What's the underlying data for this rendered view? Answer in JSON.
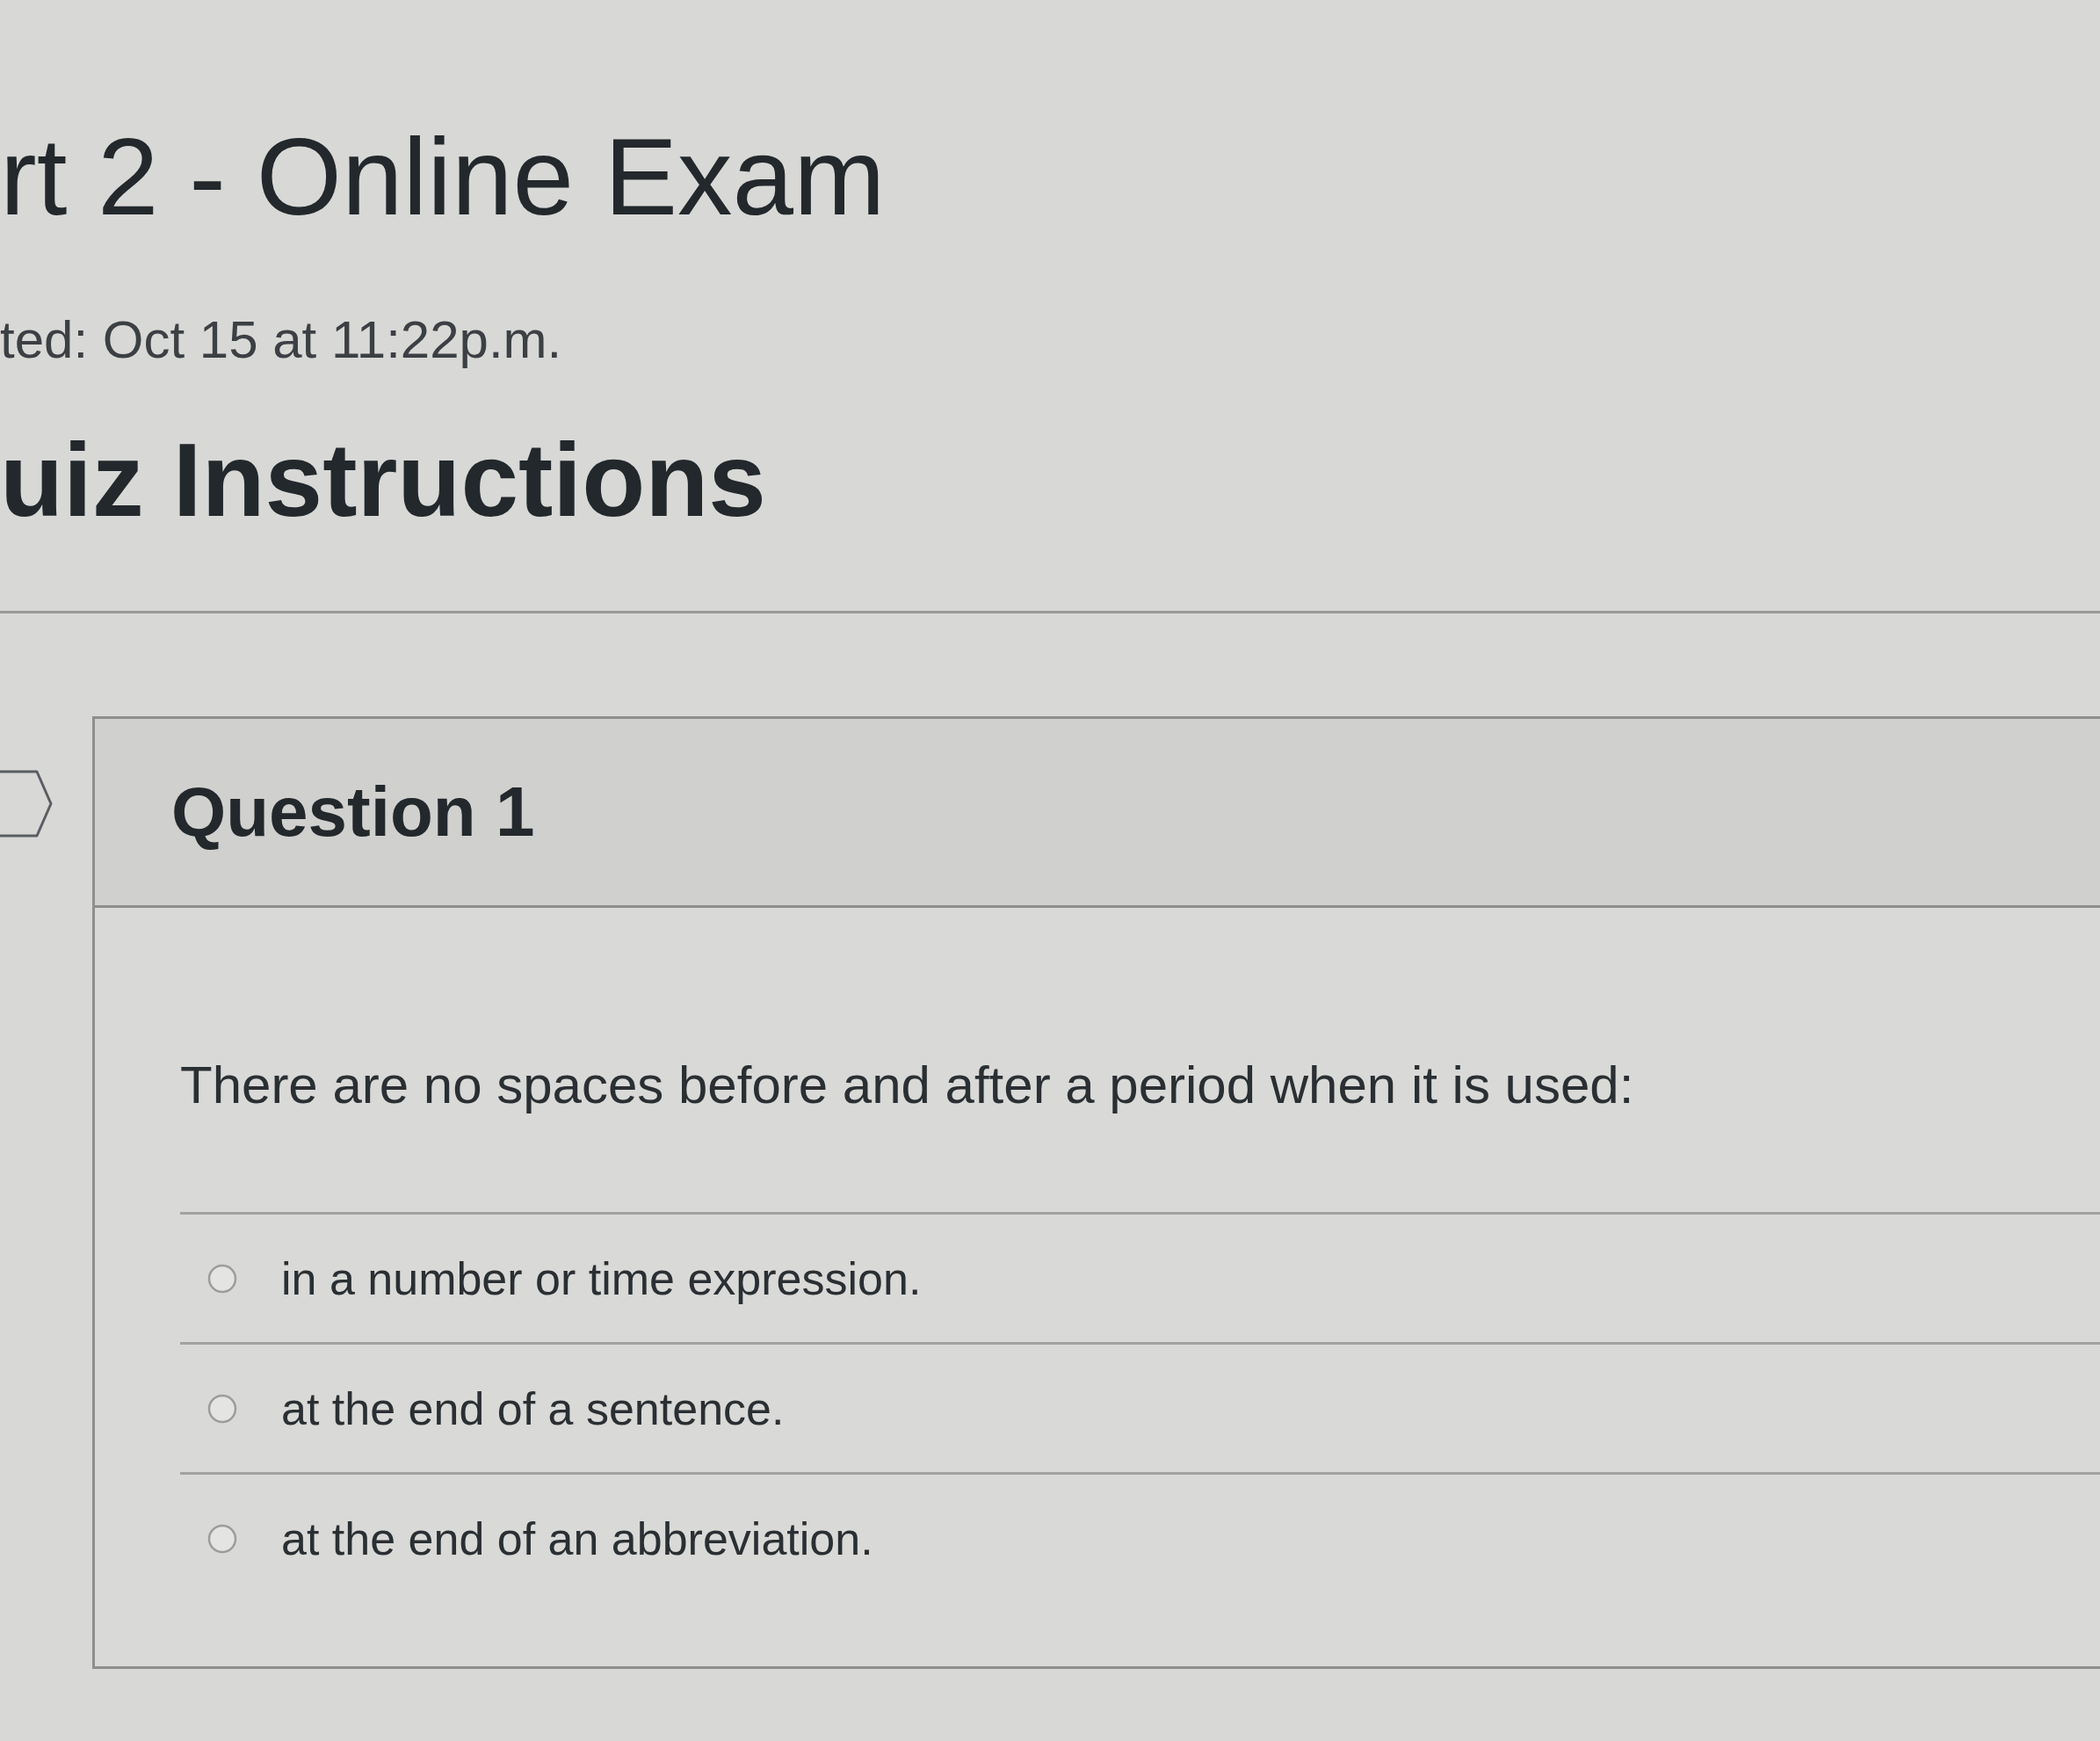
{
  "page": {
    "title": "rt 2 - Online Exam",
    "started": "ted: Oct 15 at 11:22p.m.",
    "section_heading": "uiz Instructions"
  },
  "question": {
    "flagged": false,
    "title": "Question 1",
    "text": "There are no spaces before and after a period when it is used:",
    "answers": [
      {
        "label": "in a number or time expression.",
        "selected": false
      },
      {
        "label": "at the end of a sentence.",
        "selected": false
      },
      {
        "label": "at the end of an abbreviation.",
        "selected": false
      }
    ]
  }
}
